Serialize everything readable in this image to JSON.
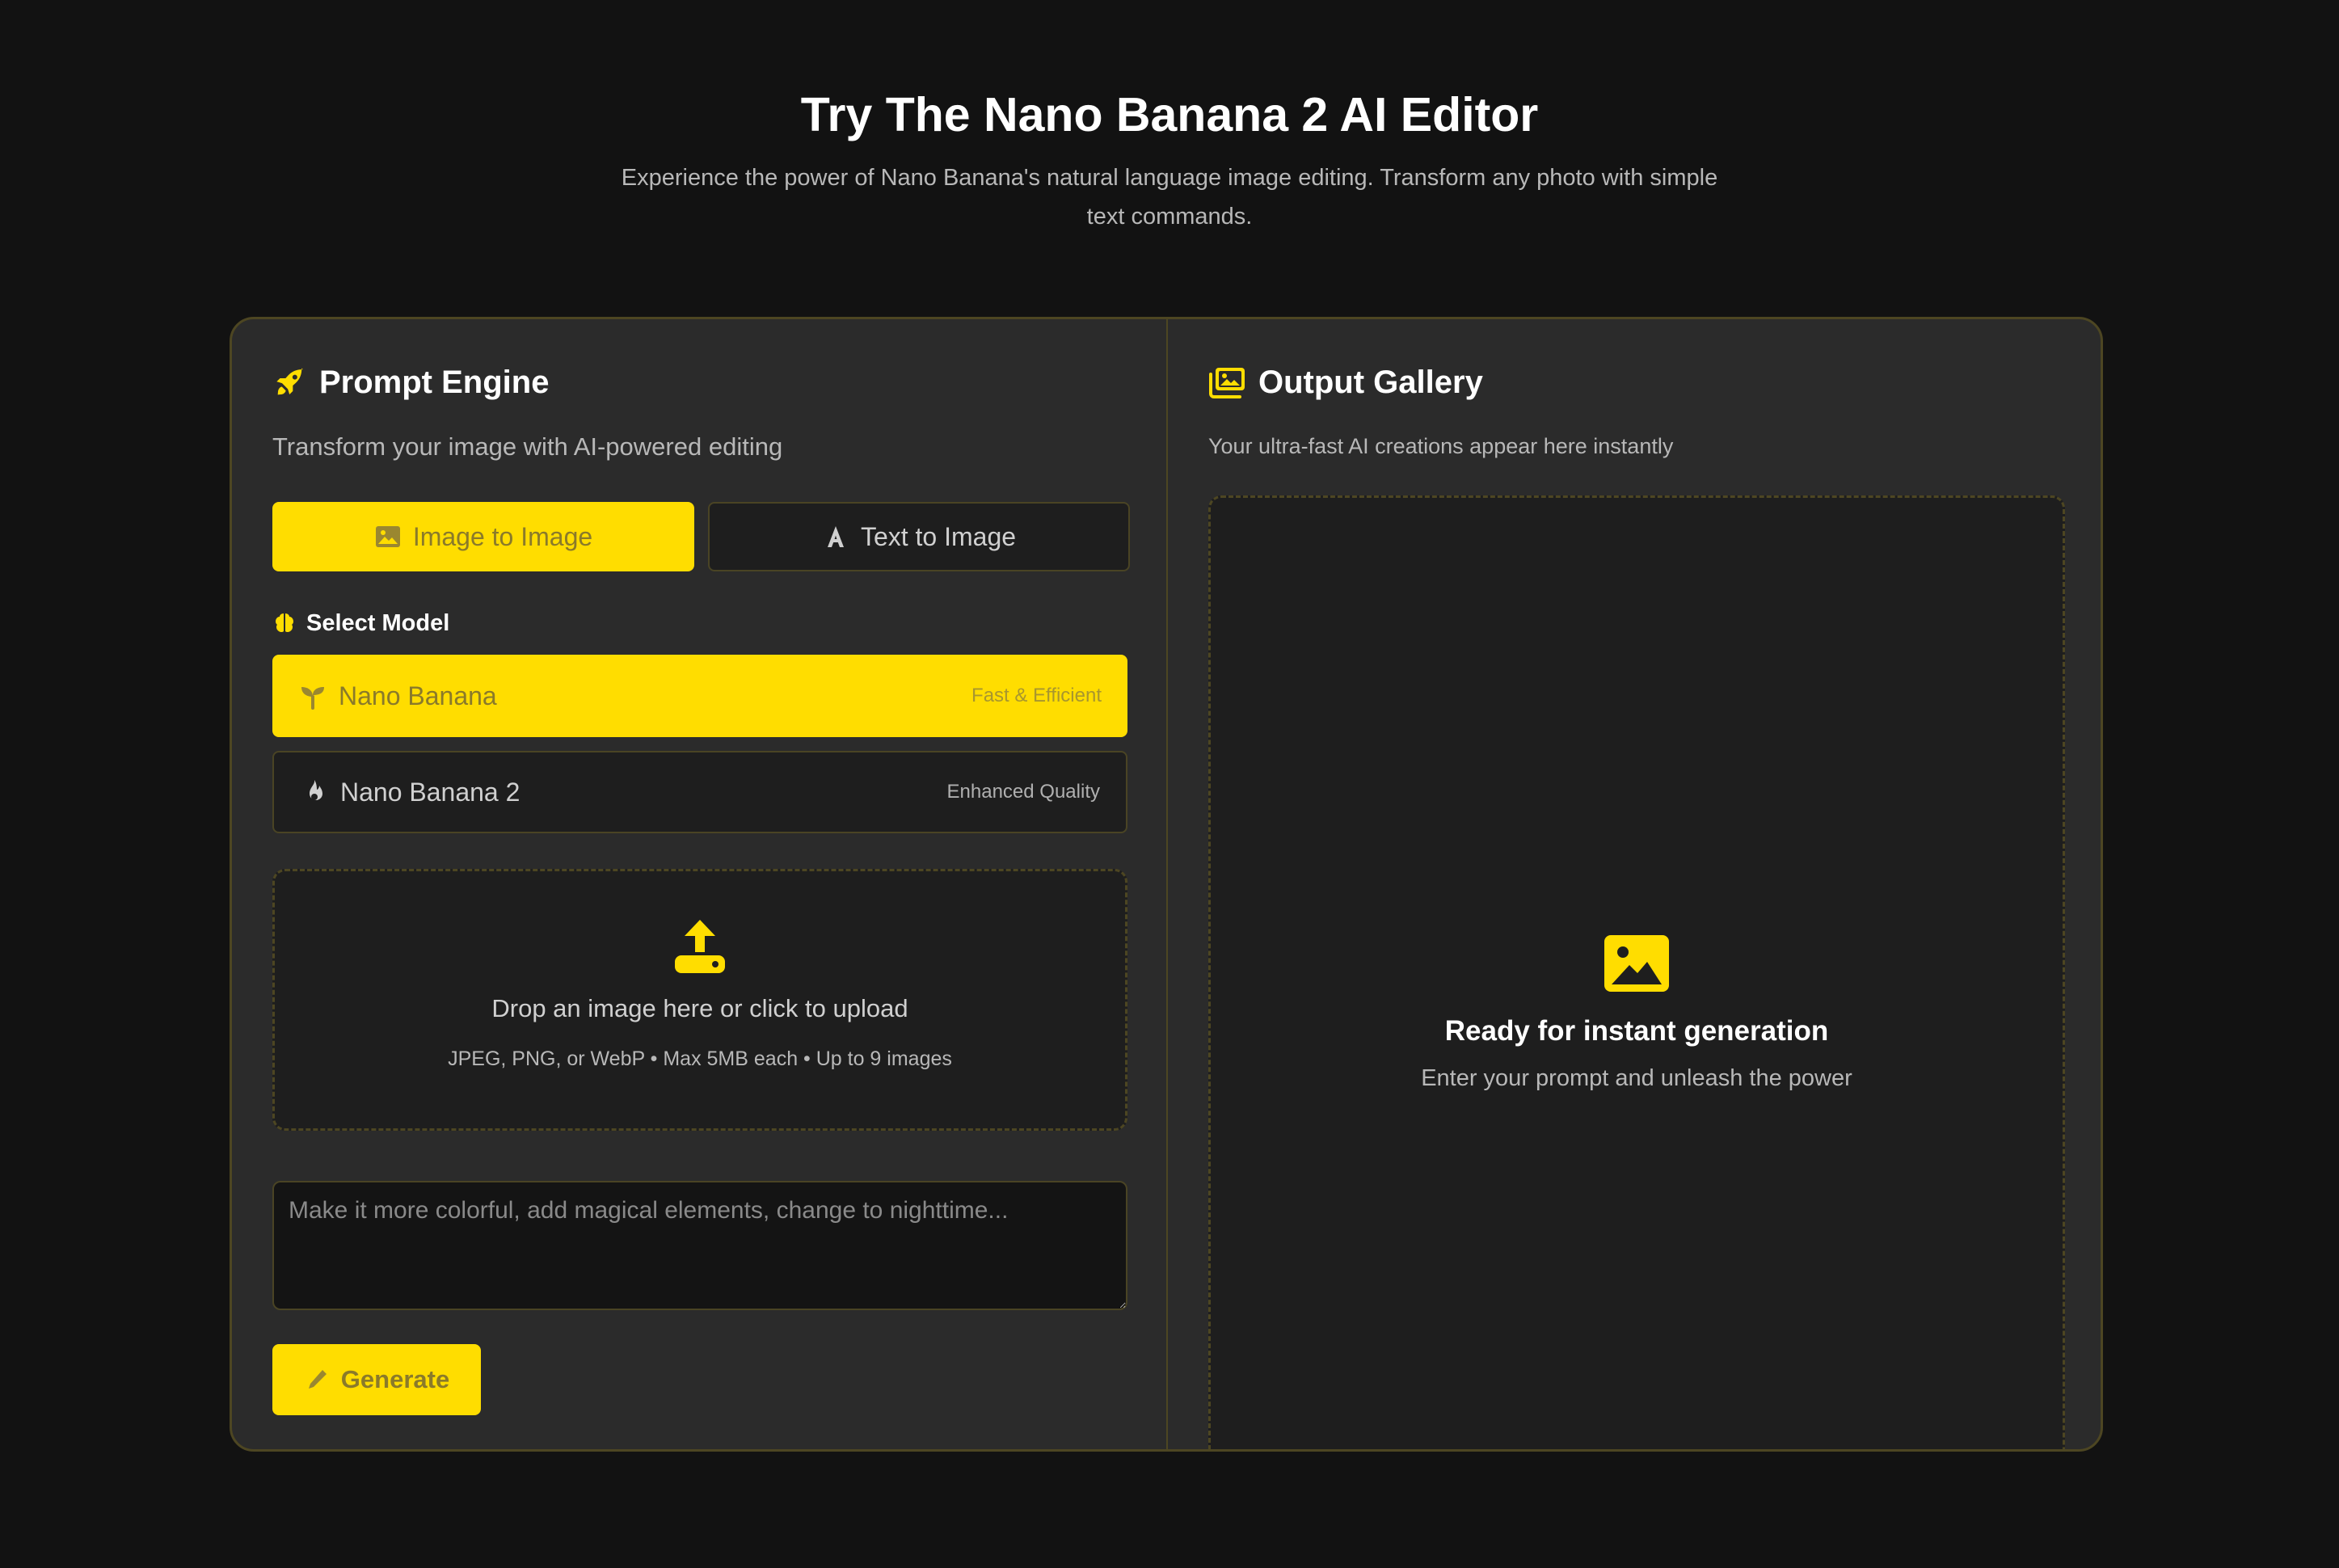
{
  "hero": {
    "title": "Try The Nano Banana 2 AI Editor",
    "subtitle": "Experience the power of Nano Banana's natural language image editing. Transform any photo with simple text commands."
  },
  "prompt_engine": {
    "title": "Prompt Engine",
    "icon": "rocket-icon",
    "description": "Transform your image with AI-powered editing",
    "modes": [
      {
        "label": "Image to Image",
        "icon": "image-icon",
        "active": true
      },
      {
        "label": "Text to Image",
        "icon": "font-a-icon",
        "active": false
      }
    ],
    "select_model_label": "Select Model",
    "select_model_icon": "brain-icon",
    "models": [
      {
        "name": "Nano Banana",
        "tag": "Fast & Efficient",
        "icon": "seedling-icon",
        "selected": true
      },
      {
        "name": "Nano Banana 2",
        "tag": "Enhanced Quality",
        "icon": "fire-icon",
        "selected": false
      }
    ],
    "upload": {
      "icon": "upload-icon",
      "main_text": "Drop an image here or click to upload",
      "sub_text": "JPEG, PNG, or WebP • Max 5MB each • Up to 9 images"
    },
    "prompt": {
      "placeholder": "Make it more colorful, add magical elements, change to nighttime...",
      "value": ""
    },
    "generate_label": "Generate",
    "generate_icon": "pen-icon"
  },
  "output_gallery": {
    "title": "Output Gallery",
    "icon": "images-icon",
    "description": "Your ultra-fast AI creations appear here instantly",
    "empty_state": {
      "icon": "image-icon",
      "title": "Ready for instant generation",
      "subtitle": "Enter your prompt and unleash the power"
    }
  },
  "colors": {
    "accent": "#ffdd00",
    "background": "#121212",
    "card": "#2b2b2b",
    "border": "#4d4622"
  }
}
